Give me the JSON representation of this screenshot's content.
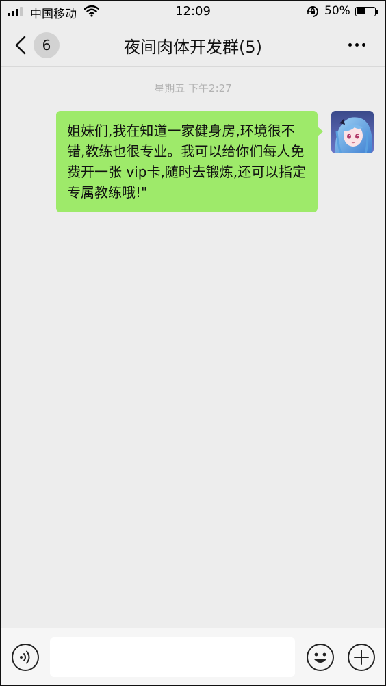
{
  "status_bar": {
    "carrier": "中国移动",
    "time": "12:09",
    "battery_percent": "50%",
    "battery_level": 0.5,
    "signal_bars": 3,
    "icons": [
      "signal-icon",
      "wifi-icon",
      "orientation-lock-icon",
      "battery-icon"
    ]
  },
  "nav": {
    "back_icon": "chevron-left-icon",
    "unread_count": "6",
    "title": "夜间肉体开发群(5)",
    "more_icon": "more-dots-icon"
  },
  "chat": {
    "timestamp": "星期五 下午2:27",
    "messages": [
      {
        "sender": "self",
        "text": "姐妹们,我在知道一家健身房,环境很不错,教练也很专业。我可以给你们每人免费开一张 vip卡,随时去锻炼,还可以指定专属教练哦!\"",
        "bubble_color": "#9eea6a"
      }
    ]
  },
  "input_bar": {
    "voice_icon": "voice-icon",
    "input_value": "",
    "emoji_icon": "emoji-icon",
    "plus_icon": "plus-icon"
  },
  "colors": {
    "background": "#ededed",
    "bubble_self": "#9eea6a",
    "timestamp_text": "#b2b2b2",
    "input_bar": "#f6f6f6"
  }
}
